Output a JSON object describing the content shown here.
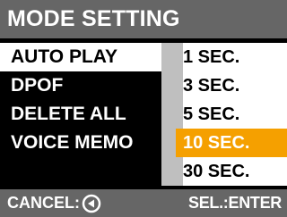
{
  "header": {
    "title": "MODE SETTING"
  },
  "menu": {
    "items": [
      {
        "label": "AUTO PLAY",
        "selected": true
      },
      {
        "label": "DPOF",
        "selected": false
      },
      {
        "label": "DELETE ALL",
        "selected": false
      },
      {
        "label": "VOICE MEMO",
        "selected": false
      }
    ]
  },
  "submenu": {
    "options": [
      {
        "label": "1 SEC.",
        "active": false
      },
      {
        "label": "3 SEC.",
        "active": false
      },
      {
        "label": "5 SEC.",
        "active": false
      },
      {
        "label": "10 SEC.",
        "active": true
      },
      {
        "label": "30 SEC.",
        "active": false
      }
    ]
  },
  "footer": {
    "cancel_label": "CANCEL:",
    "cancel_icon": "back-arrow-circle-icon",
    "enter_label": "SEL.:ENTER"
  },
  "colors": {
    "bar_gray": "#666666",
    "highlight_orange": "#f5a000",
    "scroll_track": "#bfbfbf",
    "background": "#000000"
  }
}
